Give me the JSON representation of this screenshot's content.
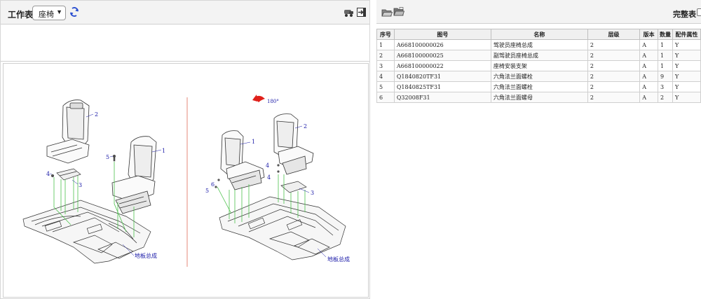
{
  "left_toolbar": {
    "worksheet_label": "工作表",
    "worksheet_value": "座椅",
    "icons": [
      "refresh-icon",
      "car-view-icon",
      "exit-icon"
    ]
  },
  "diagram": {
    "rotate_label": "180°",
    "floor_label_left": "地板总成",
    "floor_label_right": "地板总成",
    "left_callouts": [
      "2",
      "1",
      "5",
      "4",
      "3"
    ],
    "right_callouts": [
      "1",
      "2",
      "4",
      "4",
      "6",
      "5",
      "3"
    ]
  },
  "right_toolbar": {
    "icons": [
      "open-folder-icon",
      "open-folder-alt-icon"
    ],
    "complete_label": "完整表"
  },
  "parts_table": {
    "headers": [
      "序号",
      "图号",
      "名称",
      "层级",
      "版本",
      "数量",
      "配件属性"
    ],
    "rows": [
      [
        "1",
        "A668100000026",
        "驾驶员座椅总成",
        "2",
        "A",
        "1",
        "Y"
      ],
      [
        "2",
        "A668100000025",
        "副驾驶员座椅总成",
        "2",
        "A",
        "1",
        "Y"
      ],
      [
        "3",
        "A668100000022",
        "座椅安装支架",
        "2",
        "A",
        "1",
        "Y"
      ],
      [
        "4",
        "Q1840820TF31",
        "六角法兰面螺栓",
        "2",
        "A",
        "9",
        "Y"
      ],
      [
        "5",
        "Q1840825TF31",
        "六角法兰面螺栓",
        "2",
        "A",
        "3",
        "Y"
      ],
      [
        "6",
        "Q32008F31",
        "六角法兰面螺母",
        "2",
        "A",
        "2",
        "Y"
      ]
    ]
  },
  "colors": {
    "toolbar_bg": "#f3f3f3",
    "callout_blue": "#1a1aa8",
    "rotate_red": "#e0201a",
    "centerline_red": "#e48a7a",
    "leader_green": "#4cc24c"
  }
}
